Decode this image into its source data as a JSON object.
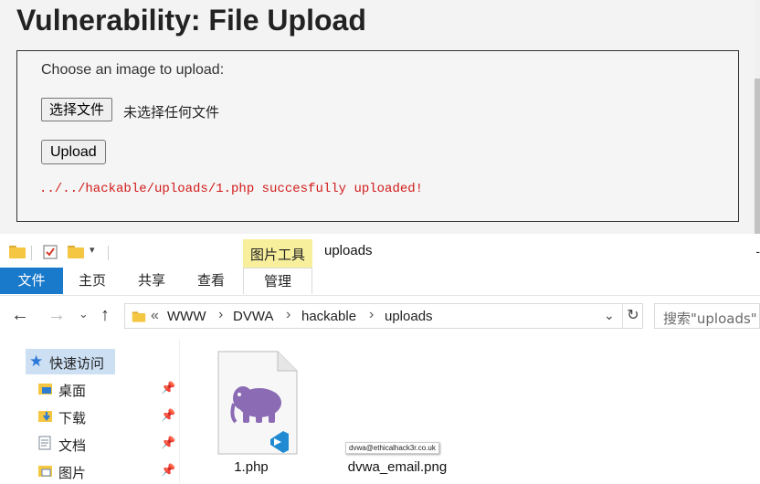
{
  "web": {
    "heading": "Vulnerability: File Upload",
    "choose_label": "Choose an image to upload:",
    "file_button": "选择文件",
    "file_status": "未选择任何文件",
    "upload_button": "Upload",
    "result_message": "../../hackable/uploads/1.php succesfully uploaded!"
  },
  "explorer": {
    "picture_tools_tab": "图片工具",
    "window_title": "uploads",
    "title_dash": "-",
    "ribbon_tabs": [
      "文件",
      "主页",
      "共享",
      "查看",
      "管理"
    ],
    "breadcrumb": [
      "WWW",
      "DVWA",
      "hackable",
      "uploads"
    ],
    "breadcrumb_prefix": "«",
    "search_placeholder": "搜索\"uploads\"",
    "nav_items": [
      {
        "label": "快速访问",
        "icon": "star-icon"
      },
      {
        "label": "桌面",
        "icon": "desktop-folder-icon"
      },
      {
        "label": "下载",
        "icon": "downloads-folder-icon"
      },
      {
        "label": "文档",
        "icon": "documents-folder-icon"
      },
      {
        "label": "图片",
        "icon": "pictures-folder-icon"
      }
    ],
    "files": [
      {
        "name": "1.php",
        "icon": "php-file-icon"
      },
      {
        "name": "dvwa_email.png",
        "icon": "png-image-icon",
        "preview_text": "dvwa@ethicalhack3r.co.uk"
      }
    ]
  },
  "colors": {
    "ribbon_file_tab": "#1979ca",
    "picture_tools_tab": "#f8ef9d",
    "success_message": "#d21a1a",
    "selected_nav": "#ccdff3"
  }
}
